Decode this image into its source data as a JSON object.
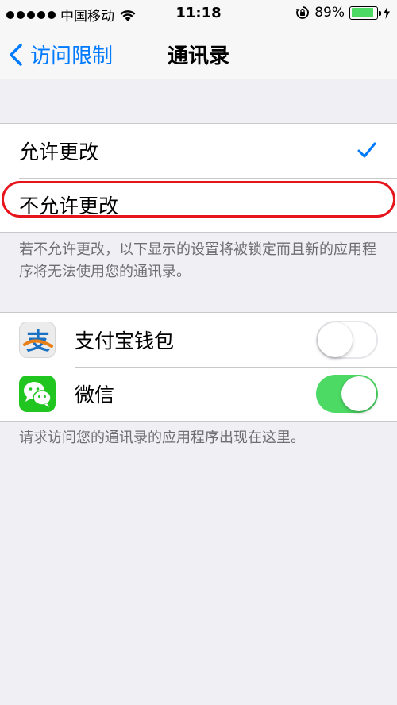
{
  "status_bar": {
    "carrier": "中国移动",
    "time": "11:18",
    "battery_percent": "89%",
    "battery_level": 0.89,
    "signal_dots": 5
  },
  "nav": {
    "back_label": "访问限制",
    "title": "通讯录"
  },
  "options": {
    "allow_label": "允许更改",
    "disallow_label": "不允许更改",
    "selected": "allow"
  },
  "options_note": "若不允许更改，以下显示的设置将被锁定而且新的应用程序将无法使用您的通讯录。",
  "apps": [
    {
      "label": "支付宝钱包",
      "icon": "alipay-icon",
      "enabled": false
    },
    {
      "label": "微信",
      "icon": "wechat-icon",
      "enabled": true
    }
  ],
  "apps_note": "请求访问您的通讯录的应用程序出现在这里。",
  "colors": {
    "accent": "#007aff",
    "toggle_on": "#4cd964",
    "highlight": "#e8141b",
    "background": "#efeff4"
  }
}
